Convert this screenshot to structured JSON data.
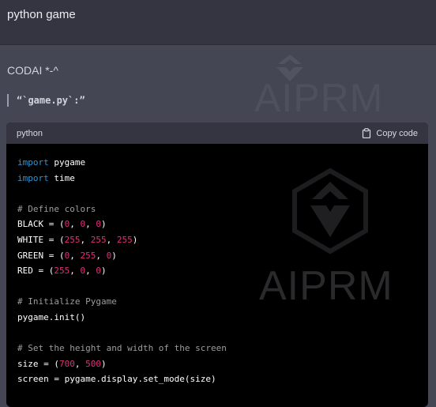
{
  "user_message": {
    "text": "python game"
  },
  "assistant": {
    "byline": "CODAI *-^",
    "quote": "“`game.py`:”",
    "watermark": "AIPRM",
    "code_block": {
      "language": "python",
      "copy_label": "Copy code",
      "lines": [
        [
          {
            "t": "import",
            "c": "kw"
          },
          {
            "t": " pygame",
            "c": ""
          }
        ],
        [
          {
            "t": "import",
            "c": "kw"
          },
          {
            "t": " time",
            "c": ""
          }
        ],
        [],
        [
          {
            "t": "# Define colors",
            "c": "cm"
          }
        ],
        [
          {
            "t": "BLACK = (",
            "c": ""
          },
          {
            "t": "0",
            "c": "num"
          },
          {
            "t": ", ",
            "c": ""
          },
          {
            "t": "0",
            "c": "num"
          },
          {
            "t": ", ",
            "c": ""
          },
          {
            "t": "0",
            "c": "num"
          },
          {
            "t": ")",
            "c": ""
          }
        ],
        [
          {
            "t": "WHITE = (",
            "c": ""
          },
          {
            "t": "255",
            "c": "num"
          },
          {
            "t": ", ",
            "c": ""
          },
          {
            "t": "255",
            "c": "num"
          },
          {
            "t": ", ",
            "c": ""
          },
          {
            "t": "255",
            "c": "num"
          },
          {
            "t": ")",
            "c": ""
          }
        ],
        [
          {
            "t": "GREEN = (",
            "c": ""
          },
          {
            "t": "0",
            "c": "num"
          },
          {
            "t": ", ",
            "c": ""
          },
          {
            "t": "255",
            "c": "num"
          },
          {
            "t": ", ",
            "c": ""
          },
          {
            "t": "0",
            "c": "num"
          },
          {
            "t": ")",
            "c": ""
          }
        ],
        [
          {
            "t": "RED = (",
            "c": ""
          },
          {
            "t": "255",
            "c": "num"
          },
          {
            "t": ", ",
            "c": ""
          },
          {
            "t": "0",
            "c": "num"
          },
          {
            "t": ", ",
            "c": ""
          },
          {
            "t": "0",
            "c": "num"
          },
          {
            "t": ")",
            "c": ""
          }
        ],
        [],
        [
          {
            "t": "# Initialize Pygame",
            "c": "cm"
          }
        ],
        [
          {
            "t": "pygame.init()",
            "c": ""
          }
        ],
        [],
        [
          {
            "t": "# Set the height and width of the screen",
            "c": "cm"
          }
        ],
        [
          {
            "t": "size = (",
            "c": ""
          },
          {
            "t": "700",
            "c": "num"
          },
          {
            "t": ", ",
            "c": ""
          },
          {
            "t": "500",
            "c": "num"
          },
          {
            "t": ")",
            "c": ""
          }
        ],
        [
          {
            "t": "screen = pygame.display.set_mode(size)",
            "c": ""
          }
        ]
      ]
    }
  },
  "colors": {
    "background": "#444654",
    "user_bar": "#343541",
    "code_bg": "#000000",
    "keyword": "#2e95d3",
    "number": "#df3079",
    "comment": "#9d9d9d"
  },
  "icons": {
    "copy": "clipboard-icon",
    "watermark": "aiprm-logo"
  }
}
